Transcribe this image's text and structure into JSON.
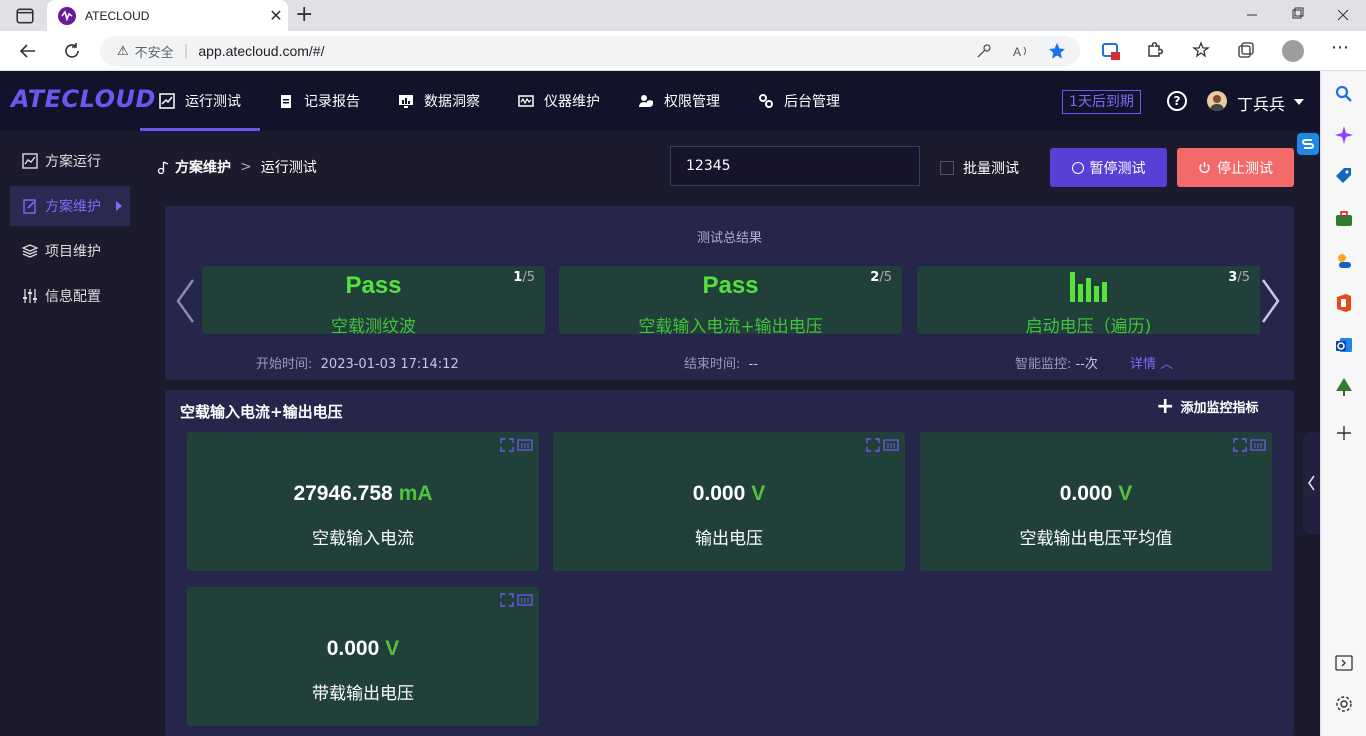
{
  "browser": {
    "tab_title": "ATECLOUD",
    "tab_new": "+",
    "url_warning": "不安全",
    "url_separator": "|",
    "url": "app.atecloud.com/#/"
  },
  "app": {
    "logo": "ATECLOUD",
    "nav": [
      {
        "label": "运行测试",
        "icon": "chart-icon",
        "active": true
      },
      {
        "label": "记录报告",
        "icon": "clipboard-icon",
        "active": false
      },
      {
        "label": "数据洞察",
        "icon": "monitor-chart-icon",
        "active": false
      },
      {
        "label": "仪器维护",
        "icon": "instrument-icon",
        "active": false
      },
      {
        "label": "权限管理",
        "icon": "shield-user-icon",
        "active": false
      },
      {
        "label": "后台管理",
        "icon": "cogs-icon",
        "active": false
      }
    ],
    "expiry": "1天后到期",
    "help": "?",
    "user": "丁兵兵",
    "accent": "#6b58f0"
  },
  "sidebar": {
    "items": [
      {
        "label": "方案运行",
        "icon": "chart-line-icon",
        "active": false
      },
      {
        "label": "方案维护",
        "icon": "edit-doc-icon",
        "active": true
      },
      {
        "label": "项目维护",
        "icon": "layers-icon",
        "active": false
      },
      {
        "label": "信息配置",
        "icon": "sliders-icon",
        "active": false
      }
    ]
  },
  "breadcrumb": {
    "root": "方案维护",
    "sep": ">",
    "current": "运行测试"
  },
  "toolbar": {
    "serial_value": "12345",
    "batch_label": "批量测试",
    "pause_label": "暂停测试",
    "stop_label": "停止测试",
    "pause_color": "#5a3fd6",
    "stop_color": "#f36a6a"
  },
  "summary": {
    "title": "测试总结果",
    "cards": [
      {
        "result": "Pass",
        "name": "空载测纹波",
        "index": "1",
        "total": "/5"
      },
      {
        "result": "Pass",
        "name": "空载输入电流+输出电压",
        "index": "2",
        "total": "/5"
      },
      {
        "result": "",
        "name": "启动电压（遍历)",
        "index": "3",
        "total": "/5"
      }
    ],
    "start_label": "开始时间:",
    "start_value": "2023-01-03 17:14:12",
    "end_label": "结束时间:",
    "end_value": "--",
    "monitor_label": "智能监控:",
    "monitor_value": "--次",
    "detail_label": "详情"
  },
  "section": {
    "title": "空载输入电流+输出电压",
    "add_label": "添加监控指标",
    "metrics": [
      {
        "value": "27946.758",
        "unit": "mA",
        "label": "空载输入电流"
      },
      {
        "value": "0.000",
        "unit": "V",
        "label": "输出电压"
      },
      {
        "value": "0.000",
        "unit": "V",
        "label": "空载输出电压平均值"
      },
      {
        "value": "0.000",
        "unit": "V",
        "label": "带载输出电压"
      }
    ]
  }
}
